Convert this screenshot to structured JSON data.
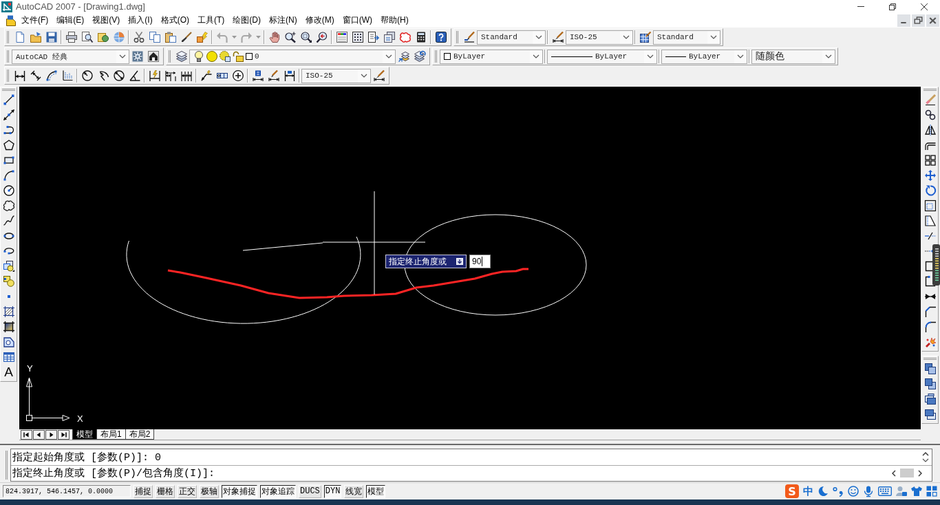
{
  "window": {
    "title": "AutoCAD 2007 - [Drawing1.dwg]"
  },
  "menu_bar": {
    "items": [
      "文件(F)",
      "编辑(E)",
      "视图(V)",
      "插入(I)",
      "格式(O)",
      "工具(T)",
      "绘图(D)",
      "标注(N)",
      "修改(M)",
      "窗口(W)",
      "帮助(H)"
    ]
  },
  "styles_toolbar": {
    "text_style": "Standard",
    "dimension_style": "ISO-25",
    "table_style": "Standard"
  },
  "workspaces_toolbar": {
    "workspace": "AutoCAD 经典"
  },
  "layers_toolbar": {
    "current_layer": "0"
  },
  "properties_toolbar": {
    "color_setting": "ByLayer",
    "linetype": "ByLayer",
    "lineweight": "ByLayer",
    "plot_style": "随颜色"
  },
  "dimension_toolbar": {
    "dimension_style": "ISO-25"
  },
  "draw_toolbar": {
    "text_tool": "A"
  },
  "canvas": {
    "prompt": "指定终止角度或",
    "input": {
      "value": "90"
    },
    "ucs": {
      "x_label": "X",
      "y_label": "Y"
    }
  },
  "layout_tabs": [
    {
      "label": "模型",
      "selected": true
    },
    {
      "label": "布局1",
      "selected": false
    },
    {
      "label": "布局2",
      "selected": false
    }
  ],
  "command_window": {
    "lines": [
      "指定起始角度或 [参数(P)]: 0",
      "指定终止角度或 [参数(P)/包含角度(I)]:"
    ]
  },
  "status_bar": {
    "coordinates": "824.3917, 546.1457, 0.0000",
    "toggles": [
      {
        "label": "捕捉",
        "on": false
      },
      {
        "label": "栅格",
        "on": false
      },
      {
        "label": "正交",
        "on": false
      },
      {
        "label": "极轴",
        "on": false
      },
      {
        "label": "对象捕捉",
        "on": true
      },
      {
        "label": "对象追踪",
        "on": true
      },
      {
        "label": "DUCS",
        "on": false
      },
      {
        "label": "DYN",
        "on": true
      },
      {
        "label": "线宽",
        "on": false
      },
      {
        "label": "模型",
        "on": true
      }
    ]
  },
  "tray": {
    "ime_logo": "S",
    "ime_mode": "中"
  }
}
